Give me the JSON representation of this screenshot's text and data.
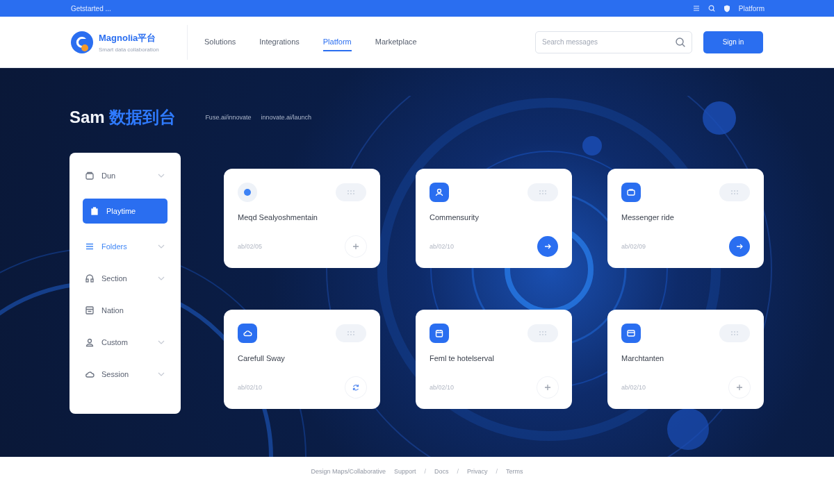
{
  "top_bar": {
    "left_text": "Getstarted ...",
    "right_text": "Platform"
  },
  "header": {
    "logo": {
      "name": "Magnolia平台",
      "tagline": "Smart data collaboration"
    },
    "nav": [
      {
        "label": "Solutions",
        "selected": false
      },
      {
        "label": "Integrations",
        "selected": false
      },
      {
        "label": "Platform",
        "selected": true
      },
      {
        "label": "Marketplace",
        "selected": false
      }
    ],
    "search": {
      "placeholder": "Search messages"
    },
    "button": "Sign in"
  },
  "hero": {
    "title": "Sam",
    "title_accent": "数据到台",
    "links": [
      "Fuse.ai/innovate",
      "innovate.ai/launch"
    ]
  },
  "sidebar": {
    "items": [
      {
        "label": "Dun",
        "kind": "box",
        "selected": false,
        "highlighted": false,
        "expandable": true
      },
      {
        "label": "Playtime",
        "kind": "badge",
        "selected": true,
        "highlighted": false,
        "expandable": false
      },
      {
        "label": "Folders",
        "kind": "menu",
        "selected": false,
        "highlighted": true,
        "expandable": true
      },
      {
        "label": "Section",
        "kind": "headset",
        "selected": false,
        "highlighted": false,
        "expandable": true
      },
      {
        "label": "Nation",
        "kind": "doc",
        "selected": false,
        "highlighted": false,
        "expandable": false
      },
      {
        "label": "Custom",
        "kind": "user",
        "selected": false,
        "highlighted": false,
        "expandable": true
      },
      {
        "label": "Session",
        "kind": "cloud",
        "selected": false,
        "highlighted": false,
        "expandable": true
      }
    ]
  },
  "cards": [
    {
      "title": "Meqd Sealyoshmentain",
      "meta": "ab/02/05",
      "kind": "dot",
      "action": {
        "kind": "plus"
      }
    },
    {
      "title": "Commensurity",
      "meta": "ab/02/10",
      "kind": "user",
      "action": {
        "kind": "arrow"
      }
    },
    {
      "title": "Messenger ride",
      "meta": "ab/02/09",
      "kind": "briefcase",
      "action": {
        "kind": "arrow"
      }
    },
    {
      "title": "Carefull Sway",
      "meta": "ab/02/10",
      "kind": "cloud",
      "action": {
        "kind": "refresh"
      }
    },
    {
      "title": "Feml te hotelserval",
      "meta": "ab/02/10",
      "kind": "calendar",
      "action": {
        "kind": "plus"
      }
    },
    {
      "title": "Marchtanten",
      "meta": "ab/02/10",
      "kind": "window",
      "action": {
        "kind": "plus"
      }
    }
  ],
  "footer": {
    "items": [
      {
        "kind": "link",
        "text": "Design Maps/Collaborative"
      },
      {
        "kind": "link",
        "text": "Support"
      },
      {
        "kind": "separator",
        "text": "/"
      },
      {
        "kind": "link",
        "text": "Docs"
      },
      {
        "kind": "separator",
        "text": "/"
      },
      {
        "kind": "link",
        "text": "Privacy"
      },
      {
        "kind": "separator",
        "text": "/"
      },
      {
        "kind": "link",
        "text": "Terms"
      }
    ]
  }
}
